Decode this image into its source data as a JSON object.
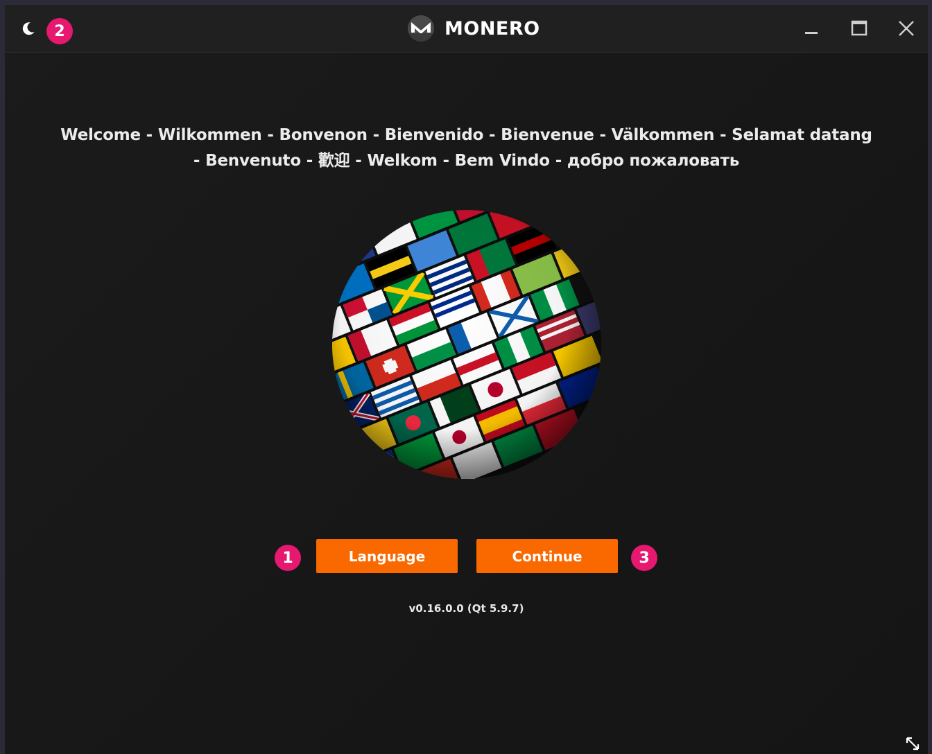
{
  "titlebar": {
    "brand_name": "MONERO",
    "theme_icon": "moon-icon",
    "controls": [
      "minimize-icon",
      "maximize-icon",
      "close-icon"
    ]
  },
  "welcome": {
    "line1": "Welcome - Wilkommen - Bonvenon - Bienvenido - Bienvenue - Välkommen - Selamat datang",
    "line2": "- Benvenuto - 歡迎 - Welkom - Bem Vindo - добро пожаловать"
  },
  "buttons": {
    "language_label": "Language",
    "continue_label": "Continue"
  },
  "version": "v0.16.0.0 (Qt 5.9.7)",
  "annotations": {
    "badge_1": "1",
    "badge_2": "2",
    "badge_3": "3"
  },
  "colors": {
    "accent": "#fa6800",
    "badge": "#e6186f",
    "background": "#1a1a1a",
    "titlebar": "#202020"
  }
}
